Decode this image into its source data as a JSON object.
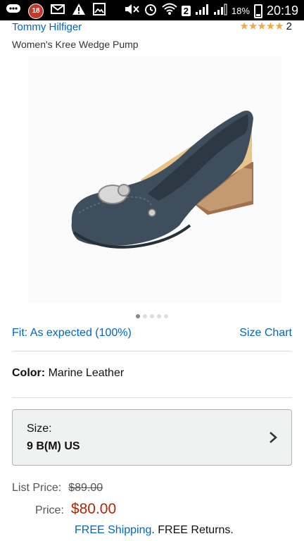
{
  "status_bar": {
    "notification_count": "18",
    "battery_pct": "18%",
    "time": "20:19",
    "sim_number": "2"
  },
  "product": {
    "brand": "Tommy Hilfiger",
    "stars": "★★★★★",
    "rating_count": "2",
    "title": "Women's Kree Wedge Pump"
  },
  "carousel": {
    "total_images": 5,
    "active_index": 0
  },
  "fit": {
    "label": "Fit: As expected (100%)",
    "size_chart": "Size Chart"
  },
  "color": {
    "label": "Color:",
    "value": "Marine Leather"
  },
  "size": {
    "label": "Size:",
    "value": "9 B(M) US"
  },
  "pricing": {
    "list_label": "List Price:",
    "list_value": "$89.00",
    "price_label": "Price:",
    "price_value": "$80.00",
    "free_shipping": "FREE Shipping",
    "free_returns": ". FREE Returns."
  },
  "colors": {
    "link": "#0066c0",
    "price": "#b12704",
    "star": "#f3a847",
    "shoe_body": "#3f4e5c"
  }
}
